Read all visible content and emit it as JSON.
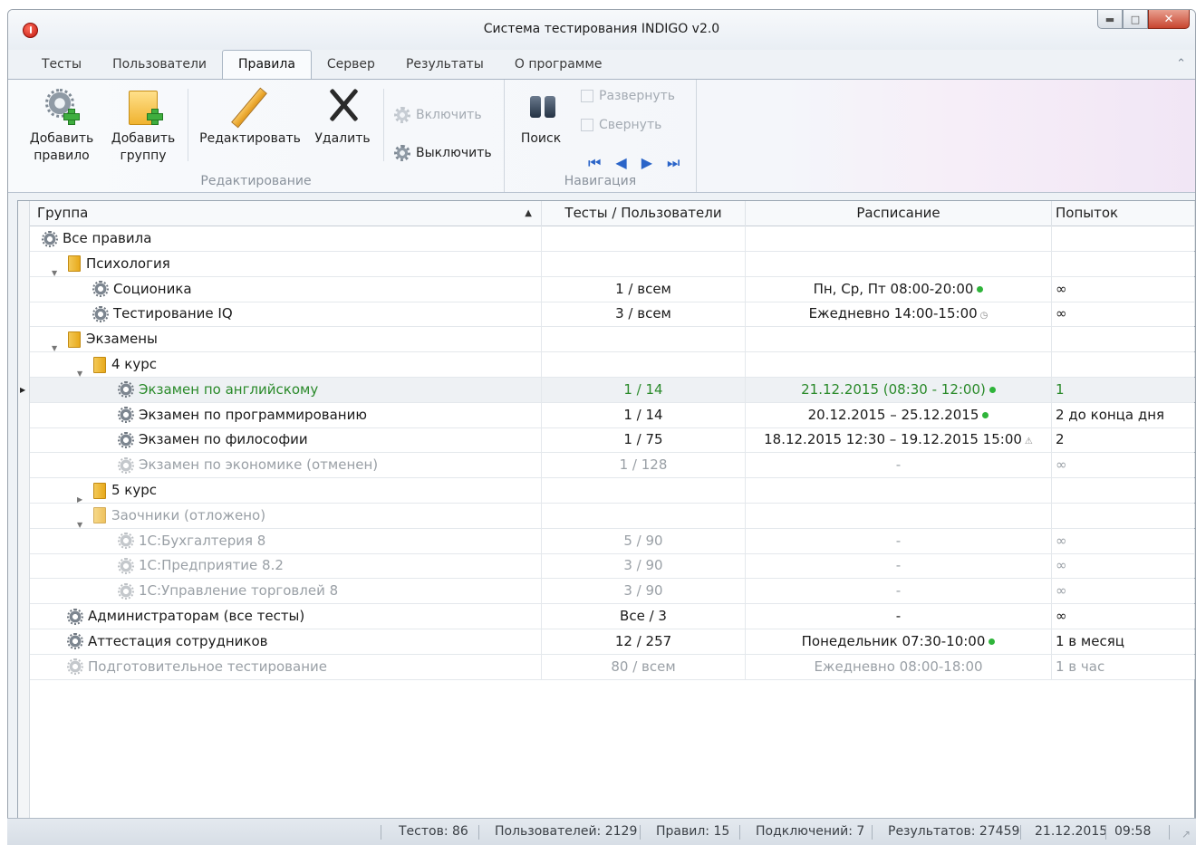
{
  "window": {
    "title": "Система тестирования INDIGO v2.0"
  },
  "tabs": [
    "Тесты",
    "Пользователи",
    "Правила",
    "Сервер",
    "Результаты",
    "О программе"
  ],
  "active_tab": "Правила",
  "ribbon": {
    "editing": {
      "label": "Редактирование",
      "add_rule_1": "Добавить",
      "add_rule_2": "правило",
      "add_group_1": "Добавить",
      "add_group_2": "группу",
      "edit": "Редактировать",
      "delete": "Удалить",
      "enable": "Включить",
      "disable": "Выключить"
    },
    "navigation": {
      "label": "Навигация",
      "search": "Поиск",
      "expand": "Развернуть",
      "collapse": "Свернуть"
    }
  },
  "grid": {
    "columns": [
      "Группа",
      "Тесты / Пользователи",
      "Расписание",
      "Попыток"
    ],
    "rows": [
      {
        "level": 0,
        "kind": "root",
        "name": "Все правила",
        "tests": "",
        "schedule": "",
        "attempts": "",
        "state": "normal"
      },
      {
        "level": 1,
        "kind": "folder",
        "expanded": true,
        "name": "Психология",
        "tests": "",
        "schedule": "",
        "attempts": "",
        "state": "normal"
      },
      {
        "level": 2,
        "kind": "rule",
        "name": "Соционика",
        "tests": "1 / всем",
        "schedule": "Пн, Ср, Пт 08:00-20:00",
        "schedule_icon": "green-dot",
        "attempts": "∞",
        "state": "normal"
      },
      {
        "level": 2,
        "kind": "rule",
        "name": "Тестирование IQ",
        "tests": "3 / всем",
        "schedule": "Ежедневно 14:00-15:00",
        "schedule_icon": "clock",
        "attempts": "∞",
        "state": "normal"
      },
      {
        "level": 1,
        "kind": "folder",
        "expanded": true,
        "name": "Экзамены",
        "tests": "",
        "schedule": "",
        "attempts": "",
        "state": "normal"
      },
      {
        "level": 2,
        "kind": "folder",
        "expanded": true,
        "name": "4 курс",
        "tests": "",
        "schedule": "",
        "attempts": "",
        "state": "normal"
      },
      {
        "level": 3,
        "kind": "rule",
        "name": "Экзамен по английскому",
        "tests": "1 / 14",
        "schedule": "21.12.2015 (08:30 - 12:00)",
        "schedule_icon": "green-dot",
        "attempts": "1",
        "state": "active",
        "selected": true
      },
      {
        "level": 3,
        "kind": "rule",
        "name": "Экзамен по программированию",
        "tests": "1 / 14",
        "schedule": "20.12.2015 – 25.12.2015",
        "schedule_icon": "green-dot",
        "attempts": "2 до конца дня",
        "state": "normal"
      },
      {
        "level": 3,
        "kind": "rule",
        "name": "Экзамен по философии",
        "tests": "1 / 75",
        "schedule": "18.12.2015 12:30 – 19.12.2015 15:00",
        "schedule_icon": "warning",
        "attempts": "2",
        "state": "normal"
      },
      {
        "level": 3,
        "kind": "rule",
        "name": "Экзамен по экономике (отменен)",
        "tests": "1 / 128",
        "schedule": "-",
        "attempts": "∞",
        "state": "disabled"
      },
      {
        "level": 2,
        "kind": "folder",
        "expanded": false,
        "name": "5 курс",
        "tests": "",
        "schedule": "",
        "attempts": "",
        "state": "normal"
      },
      {
        "level": 2,
        "kind": "folder",
        "expanded": true,
        "name": "Заочники (отложено)",
        "tests": "",
        "schedule": "",
        "attempts": "",
        "state": "disabled"
      },
      {
        "level": 3,
        "kind": "rule",
        "name": "1С:Бухгалтерия 8",
        "tests": "5 / 90",
        "schedule": "-",
        "attempts": "∞",
        "state": "disabled"
      },
      {
        "level": 3,
        "kind": "rule",
        "name": "1С:Предприятие 8.2",
        "tests": "3 / 90",
        "schedule": "-",
        "attempts": "∞",
        "state": "disabled"
      },
      {
        "level": 3,
        "kind": "rule",
        "name": "1С:Управление торговлей 8",
        "tests": "3 / 90",
        "schedule": "-",
        "attempts": "∞",
        "state": "disabled"
      },
      {
        "level": 1,
        "kind": "rule",
        "name": "Администраторам (все тесты)",
        "tests": "Все / 3",
        "schedule": "-",
        "attempts": "∞",
        "state": "normal"
      },
      {
        "level": 1,
        "kind": "rule",
        "name": "Аттестация сотрудников",
        "tests": "12 / 257",
        "schedule": "Понедельник 07:30-10:00",
        "schedule_icon": "green-dot",
        "attempts": "1 в месяц",
        "state": "normal"
      },
      {
        "level": 1,
        "kind": "rule",
        "name": "Подготовительное тестирование",
        "tests": "80 / всем",
        "schedule": "Ежедневно 08:00-18:00",
        "attempts": "1 в час",
        "state": "disabled"
      }
    ]
  },
  "status": {
    "tests": "Тестов: 86",
    "users": "Пользователей: 2129",
    "rules": "Правил: 15",
    "connections": "Подключений: 7",
    "results": "Результатов: 27459",
    "date": "21.12.2015",
    "time": "09:58"
  },
  "colors": {
    "active_row": "#2a8a2a",
    "disabled_row": "#9aa0a6",
    "status_dot": "#2fb43a"
  }
}
